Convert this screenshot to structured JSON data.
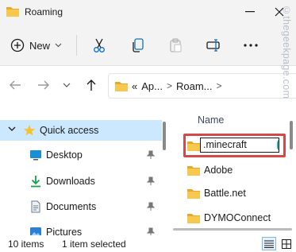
{
  "window": {
    "title": "Roaming"
  },
  "toolbar": {
    "new_label": "New",
    "icons": [
      "plus-circle-icon",
      "scissors-icon",
      "copy-icon",
      "paste-icon",
      "rename-icon",
      "more-icon"
    ]
  },
  "address": {
    "crumbs": [
      "Ap...",
      "Roam..."
    ],
    "overflow": "«",
    "separator": ">"
  },
  "nav": {
    "items": [
      {
        "label": "Quick access",
        "icon": "star-icon",
        "selected": true
      },
      {
        "label": "Desktop",
        "icon": "desktop-icon",
        "pinned": true
      },
      {
        "label": "Downloads",
        "icon": "download-icon",
        "pinned": true
      },
      {
        "label": "Documents",
        "icon": "document-icon",
        "pinned": true
      },
      {
        "label": "Pictures",
        "icon": "pictures-icon",
        "pinned": true
      }
    ]
  },
  "files": {
    "column_name": "Name",
    "rename_value": ".minecraft",
    "rows": [
      {
        "label": "Adobe"
      },
      {
        "label": "Battle.net"
      },
      {
        "label": "DYMOConnect"
      }
    ]
  },
  "status": {
    "count": "10 items",
    "selection": "1 item selected"
  },
  "watermark": "©thegeekpage.com",
  "colors": {
    "accent": "#0067c0",
    "folder": "#f8c74e",
    "selection": "#cce8ff",
    "highlight": "#d54848"
  }
}
